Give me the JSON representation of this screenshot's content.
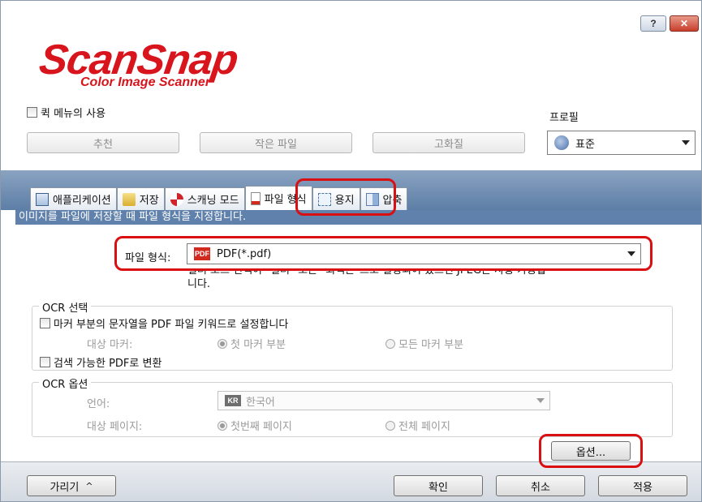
{
  "window": {
    "help_glyph": "?",
    "close_glyph": "✕"
  },
  "logo": {
    "main": "ScanSnap",
    "sub": "Color Image Scanner"
  },
  "top": {
    "quick_menu_label": "퀵 메뉴의 사용",
    "profile_label": "프로필",
    "profile_buttons": [
      "추천",
      "작은 파일",
      "고화질"
    ],
    "profile_value": "표준"
  },
  "tabs": [
    {
      "label": "애플리케이션",
      "icon": "application-icon"
    },
    {
      "label": "저장",
      "icon": "folder-icon"
    },
    {
      "label": "스캐닝 모드",
      "icon": "scan-mode-icon"
    },
    {
      "label": "파일 형식",
      "icon": "file-format-icon",
      "active": true
    },
    {
      "label": "용지",
      "icon": "paper-icon"
    },
    {
      "label": "압축",
      "icon": "compression-icon"
    }
  ],
  "file_format": {
    "description": "이미지를 파일에 저장할 때 파일 형식을 지정합니다.",
    "label": "파일 형식:",
    "icon_text": "PDF",
    "value": "PDF(*.pdf)",
    "note_partial": "컬러 모드 선택이 \"컬러\" 또는 \"회색톤\"으로 설정되어 있으면 JPEG는 사용 가능합",
    "note_end": "니다."
  },
  "ocr_select": {
    "title": "OCR 선택",
    "marker_checkbox_label": "마커 부분의 문자열을 PDF 파일 키워드로 설정합니다",
    "target_marker_label": "대상 마커:",
    "first_marker": "첫 마커 부분",
    "all_markers": "모든 마커 부분",
    "searchable_pdf_label": "검색 가능한 PDF로 변환"
  },
  "ocr_options": {
    "title": "OCR 옵션",
    "language_label": "언어:",
    "language_icon_text": "KR",
    "language_value": "한국어",
    "target_page_label": "대상 페이지:",
    "first_page": "첫번째 페이지",
    "all_pages": "전체 페이지"
  },
  "options_button": "옵션...",
  "footer": {
    "hide_button": "가리기",
    "hide_glyph": "^",
    "ok_button": "확인",
    "cancel_button": "취소",
    "apply_button": "적용"
  },
  "colors": {
    "highlight": "#d90f12",
    "brand_red": "#d8141c",
    "band_blue": "#5f81ab"
  }
}
